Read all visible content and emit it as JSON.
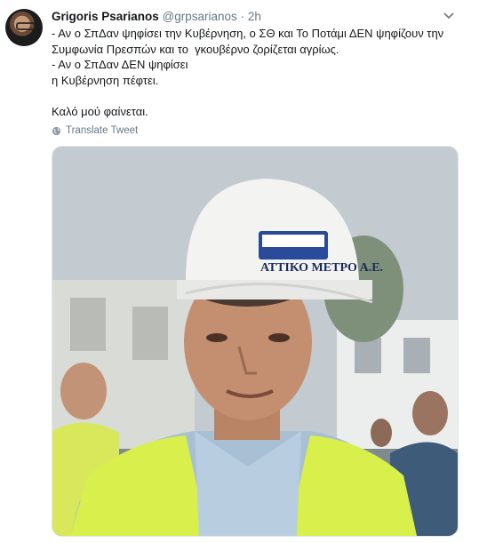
{
  "tweet": {
    "author_name": "Grigoris Psarianos",
    "handle": "@grpsarianos",
    "separator": "·",
    "time": "2h",
    "lines": [
      "- Αν ο ΣπΔαν ψηφίσει την Κυβέρνηση, ο ΣΘ και Το Ποτάμι ΔΕΝ ψηφίζουν την",
      "Συμφωνία Πρεσπών και το  γκουβέρνο ζορίζεται αγρίως.",
      "- Αν ο ΣπΔαν ΔΕΝ ψηφίσει",
      "η Κυβέρνηση πέφτει.",
      "Καλό μού φαίνεται."
    ],
    "translate_label": "Translate Tweet"
  },
  "photo": {
    "helmet_label": "ΑΤΤΙΚΟ ΜΕΤΡΟ Α.Ε."
  },
  "icons": {
    "chevron": "chevron-down-icon",
    "globe": "globe-icon"
  },
  "colors": {
    "name": "#14171a",
    "secondary": "#657786",
    "border": "#e1e8ed",
    "vest": "#d6f04a",
    "helmet": "#f3f4f2"
  }
}
